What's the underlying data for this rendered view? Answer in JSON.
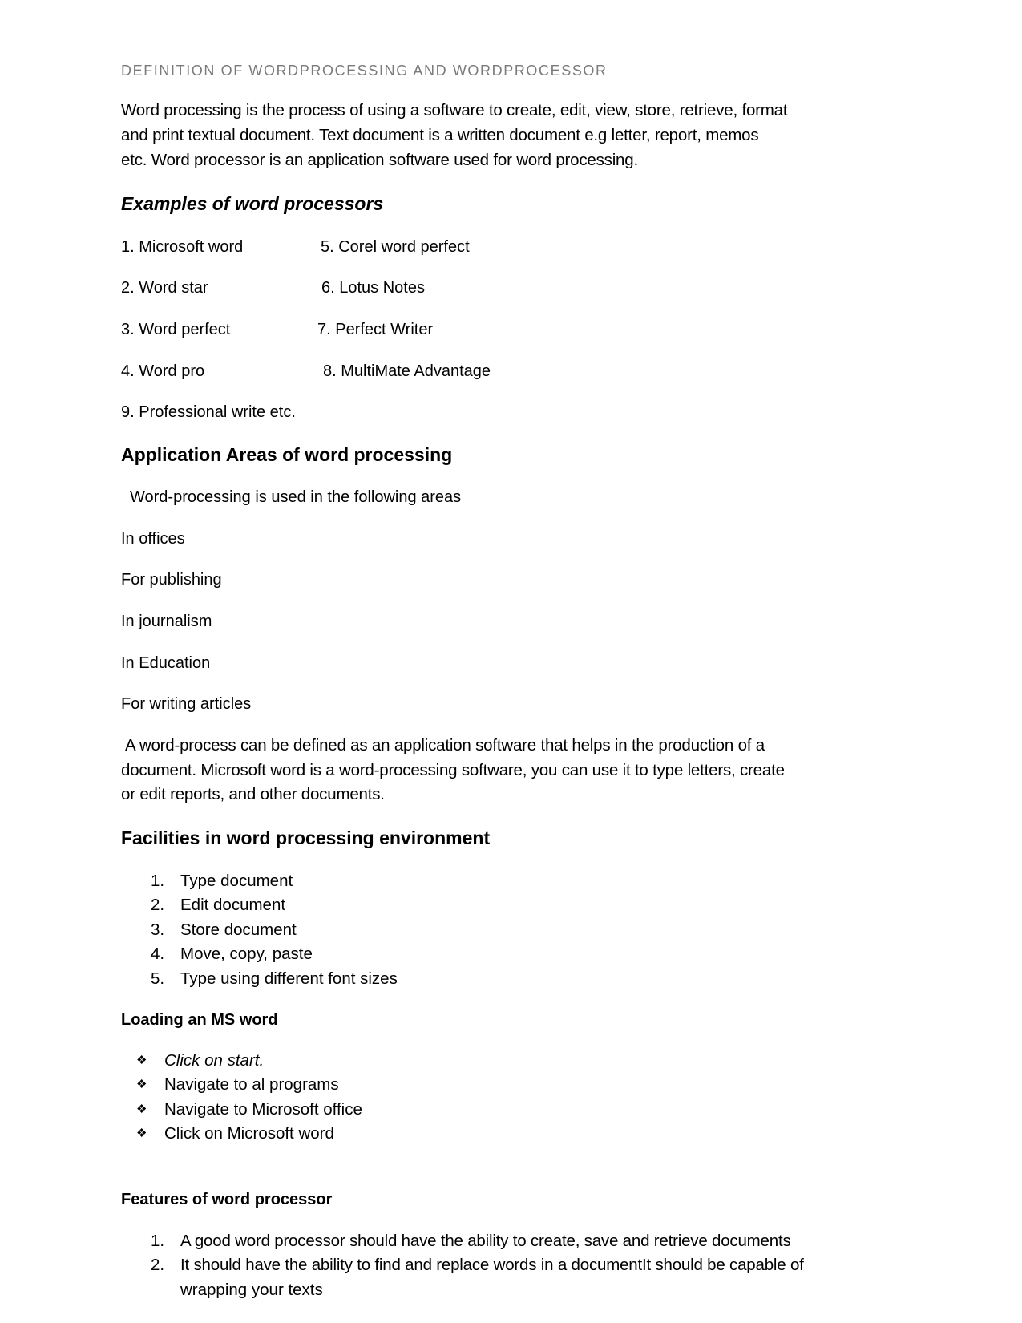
{
  "document": {
    "title": "DEFINITION OF WORDPROCESSING AND WORDPROCESSOR",
    "intro_lines": [
      "Word processing is the process of using a software to create, edit, view, store, retrieve, format",
      "and print textual document. Text document is a written document e.g letter, report, memos",
      "etc. Word processor is an application software used for word processing."
    ],
    "examples": {
      "heading": "Examples of word processors",
      "left_column": [
        "1. Microsoft word",
        "2. Word star",
        "3. Word perfect",
        "4. Word pro",
        "9. Professional write etc."
      ],
      "right_column": [
        "5. Corel word perfect",
        "6. Lotus Notes",
        "7. Perfect Writer",
        "8. MultiMate Advantage"
      ]
    },
    "application_areas": {
      "heading": "Application Areas of word processing",
      "intro": "Word-processing is used in the following areas",
      "items": [
        "In offices",
        "For publishing",
        "In journalism",
        "In Education",
        "For writing articles"
      ]
    },
    "definition_lines": [
      "A word-process can be defined as an application software that helps in the production of a",
      "document. Microsoft word is a word-processing software, you can use it to type letters, create",
      "or edit reports, and other documents."
    ],
    "facilities": {
      "heading": "Facilities in word processing environment",
      "items": [
        {
          "number": "1.",
          "text": "Type document"
        },
        {
          "number": "2.",
          "text": "Edit document"
        },
        {
          "number": "3.",
          "text": "Store document"
        },
        {
          "number": "4.",
          "text": "Move, copy, paste"
        },
        {
          "number": "5.",
          "text": "Type using different font sizes"
        }
      ]
    },
    "loading": {
      "heading": "Loading an MS word",
      "bullet_icon": "diamond-bullet-icon",
      "bullet_glyph": "❖",
      "items": [
        "Click on start.",
        "Navigate to al programs",
        "Navigate to Microsoft office",
        "Click on Microsoft word"
      ]
    },
    "features": {
      "heading": "Features of word processor",
      "items": [
        {
          "number": "1.",
          "lines": [
            "A good word processor should have the ability to create, save and retrieve documents"
          ]
        },
        {
          "number": "2.",
          "lines": [
            "It should have the ability to find and replace words in a documentIt should be capable of",
            "wrapping your texts"
          ]
        }
      ]
    }
  }
}
